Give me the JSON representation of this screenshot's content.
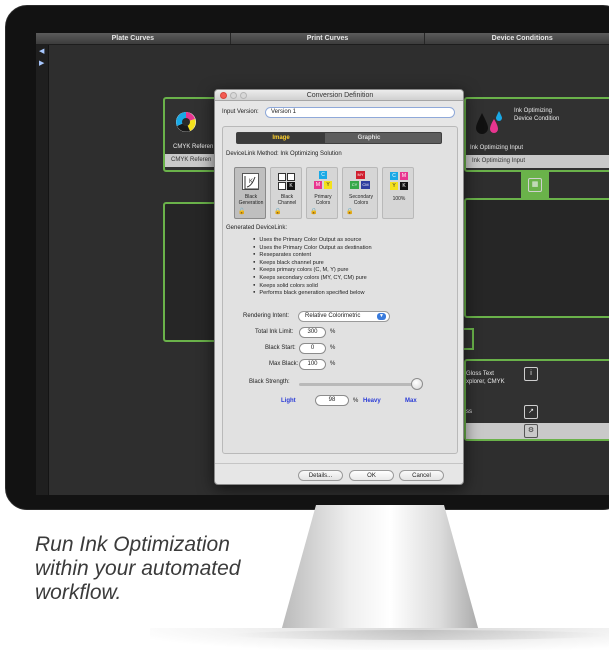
{
  "app": {
    "header_tabs": [
      "Plate Curves",
      "Print Curves",
      "Device Conditions"
    ]
  },
  "canvas": {
    "left_node": {
      "title": "CMYK Referen",
      "bar": "CMYK Referen"
    },
    "right_node": {
      "title_line1": "Ink Optimizing",
      "title_line2": "Device Condition",
      "bar": "Ink Optimizing Input",
      "bar2": "Ink Optimizing Input"
    },
    "lower_node": {
      "line1": "Gloss Text",
      "line2": "xplorer, CMYK",
      "line3": "ss"
    }
  },
  "dialog": {
    "title": "Conversion Definition",
    "input_version_label": "Input Version:",
    "input_version_value": "Version 1",
    "tabs": [
      {
        "label": "Image",
        "active": true
      },
      {
        "label": "Graphic",
        "active": false
      }
    ],
    "method_heading": "DeviceLink Method: Ink Optimizing Solution",
    "methods": [
      {
        "label_line1": "Black",
        "label_line2": "Generation",
        "selected": true,
        "locked": false,
        "unlocked": true
      },
      {
        "label_line1": "Black",
        "label_line2": "Channel",
        "selected": false,
        "locked": true,
        "unlocked": false
      },
      {
        "label_line1": "Primary",
        "label_line2": "Colors",
        "selected": false,
        "locked": true,
        "unlocked": false
      },
      {
        "label_line1": "Secondary",
        "label_line2": "Colors",
        "selected": false,
        "locked": true,
        "unlocked": false
      },
      {
        "label_line1": "100%",
        "label_line2": "",
        "selected": false,
        "locked": false,
        "unlocked": false
      }
    ],
    "generated_heading": "Generated DeviceLink:",
    "bullets": [
      "Uses the Primary Color Output as source",
      "Uses the Primary Color Output as destination",
      "Reseparates content",
      "Keeps black channel pure",
      "Keeps primary colors (C, M, Y) pure",
      "Keeps secondary colors (MY, CY, CM) pure",
      "Keeps solid colors solid",
      "Performs black generation specified below"
    ],
    "rendering_intent_label": "Rendering Intent:",
    "rendering_intent_value": "Relative Colorimetric",
    "total_ink_label": "Total Ink Limit:",
    "total_ink_value": "300",
    "black_start_label": "Black Start:",
    "black_start_value": "0",
    "max_black_label": "Max Black:",
    "max_black_value": "100",
    "percent": "%",
    "black_strength_label": "Black Strength:",
    "black_strength_fraction": 0.98,
    "light_label": "Light",
    "strength_value": "98",
    "heavy_label": "Heavy",
    "max_label": "Max",
    "buttons": {
      "details": "Details...",
      "ok": "OK",
      "cancel": "Cancel"
    }
  },
  "tagline": [
    "Run Ink Optimization",
    "within your automated",
    "workflow."
  ],
  "colors": {
    "node_border": "#6ab24a",
    "active_tab_text": "#ffd22e",
    "link_blue": "#2a3bd6",
    "lock_red": "#d02020"
  }
}
